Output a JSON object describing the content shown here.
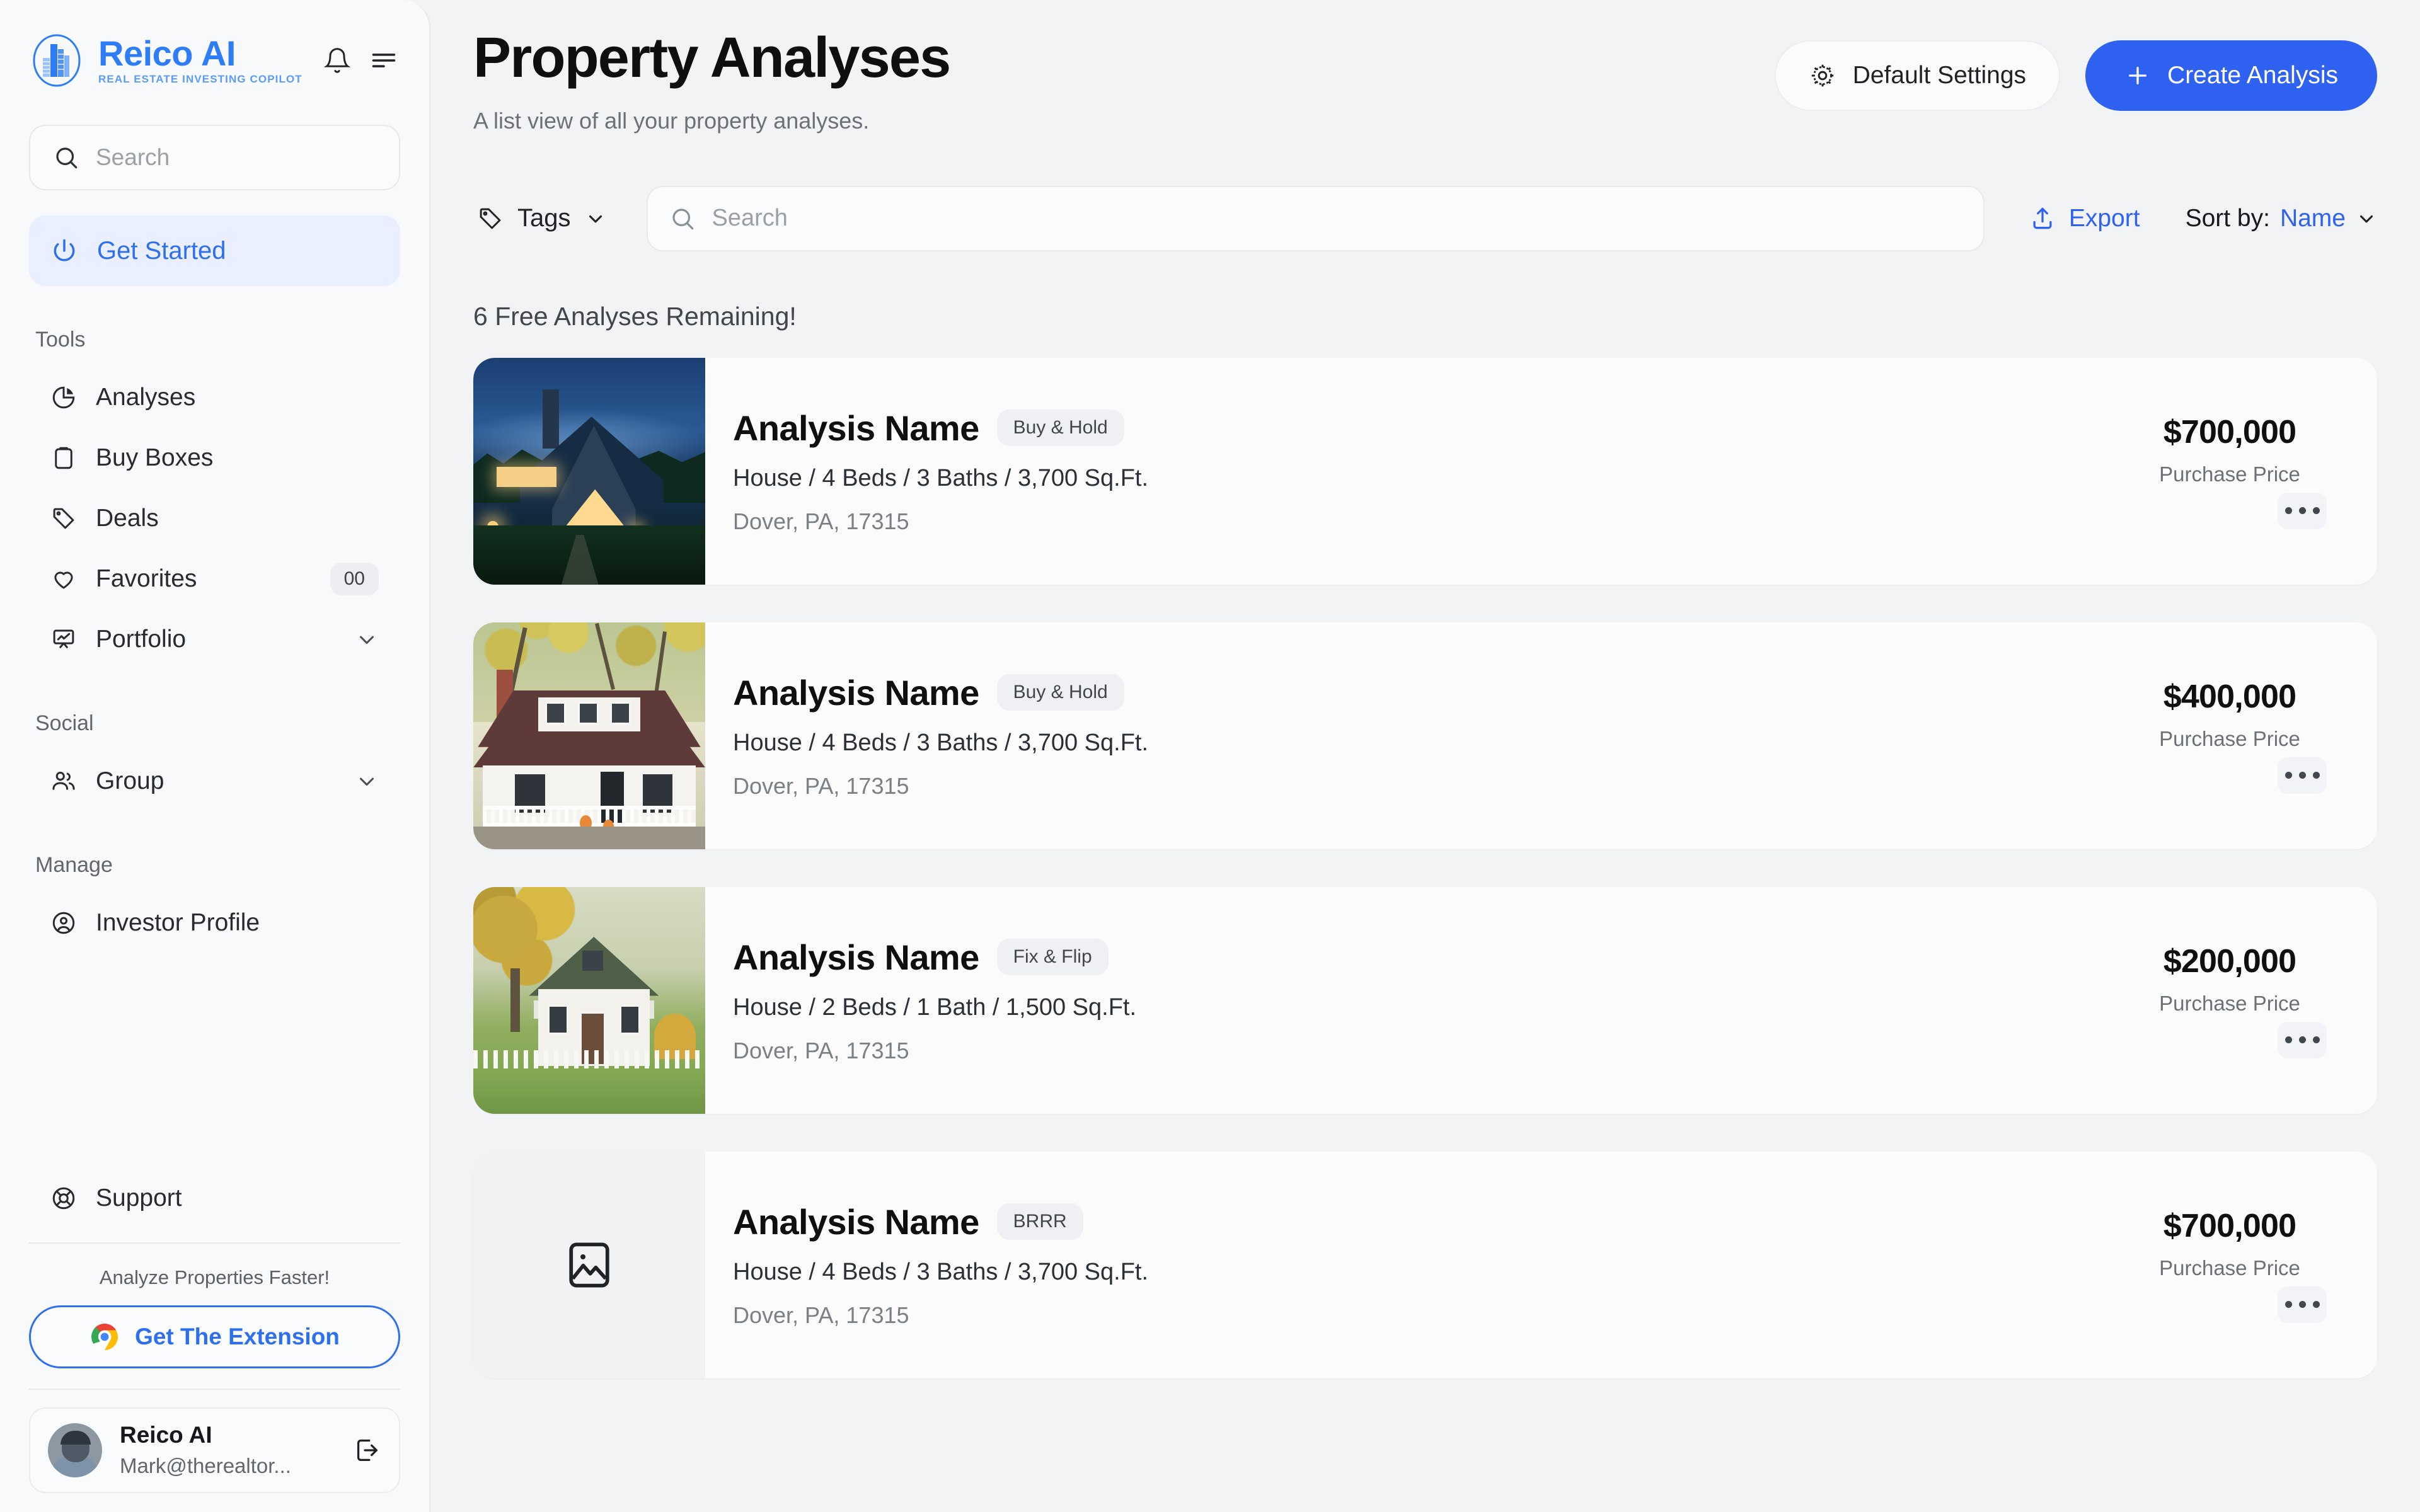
{
  "brand": {
    "name": "Reico AI",
    "tagline": "REAL ESTATE INVESTING COPILOT",
    "accent": "#2f7df6"
  },
  "sidebar": {
    "search": {
      "placeholder": "Search",
      "value": ""
    },
    "primary": {
      "label": "Get Started",
      "icon": "power-icon"
    },
    "sections": [
      {
        "label": "Tools",
        "items": [
          {
            "label": "Analyses",
            "icon": "pie-chart-icon"
          },
          {
            "label": "Buy Boxes",
            "icon": "clipboard-icon"
          },
          {
            "label": "Deals",
            "icon": "tag-icon"
          },
          {
            "label": "Favorites",
            "icon": "heart-icon",
            "count": "00"
          },
          {
            "label": "Portfolio",
            "icon": "presentation-chart-icon",
            "chevron": true
          }
        ]
      },
      {
        "label": "Social",
        "items": [
          {
            "label": "Group",
            "icon": "users-icon",
            "chevron": true
          }
        ]
      },
      {
        "label": "Manage",
        "items": [
          {
            "label": "Investor Profile",
            "icon": "user-circle-icon"
          }
        ]
      }
    ],
    "support": {
      "label": "Support",
      "icon": "lifebuoy-icon"
    },
    "promo": {
      "text": "Analyze Properties Faster!",
      "button_label": "Get The Extension",
      "button_icon": "chrome-icon"
    },
    "user": {
      "name": "Reico AI",
      "email": "Mark@therealtor...",
      "logout_icon": "logout-icon"
    }
  },
  "header": {
    "title": "Property Analyses",
    "subtitle": "A list view of all your property analyses.",
    "default_settings_label": "Default Settings",
    "default_settings_icon": "gear-icon",
    "create_label": "Create Analysis",
    "create_icon": "plus-icon",
    "create_color": "#2f62f0"
  },
  "toolbar": {
    "tags_label": "Tags",
    "tags_icon": "tag-icon",
    "search_placeholder": "Search",
    "search_value": "",
    "export_label": "Export",
    "export_icon": "upload-icon",
    "sort_label": "Sort by:",
    "sort_value": "Name"
  },
  "main": {
    "free_note": "6 Free Analyses Remaining!",
    "price_caption": "Purchase Price",
    "more_icon": "ellipsis-icon",
    "cards": [
      {
        "name": "Analysis Name",
        "badge": "Buy & Hold",
        "specs": "House / 4 Beds / 3 Baths / 3,700 Sq.Ft.",
        "address": "Dover, PA, 17315",
        "price": "$700,000",
        "price_label": "Purchase Price",
        "image": "twilight-modern-cabin-photo"
      },
      {
        "name": "Analysis Name",
        "badge": "Buy & Hold",
        "specs": "House / 4 Beds / 3 Baths / 3,700 Sq.Ft.",
        "address": "Dover, PA, 17315",
        "price": "$400,000",
        "price_label": "Purchase Price",
        "image": "white-house-autumn-photo"
      },
      {
        "name": "Analysis Name",
        "badge": "Fix & Flip",
        "specs": "House / 2 Beds / 1 Bath / 1,500 Sq.Ft.",
        "address": "Dover, PA, 17315",
        "price": "$200,000",
        "price_label": "Purchase Price",
        "image": "white-cottage-lawn-photo"
      },
      {
        "name": "Analysis Name",
        "badge": "BRRR",
        "specs": "House / 4 Beds / 3 Baths / 3,700 Sq.Ft.",
        "address": "Dover, PA, 17315",
        "price": "$700,000",
        "price_label": "Purchase Price",
        "image": "image-placeholder-icon"
      }
    ]
  }
}
